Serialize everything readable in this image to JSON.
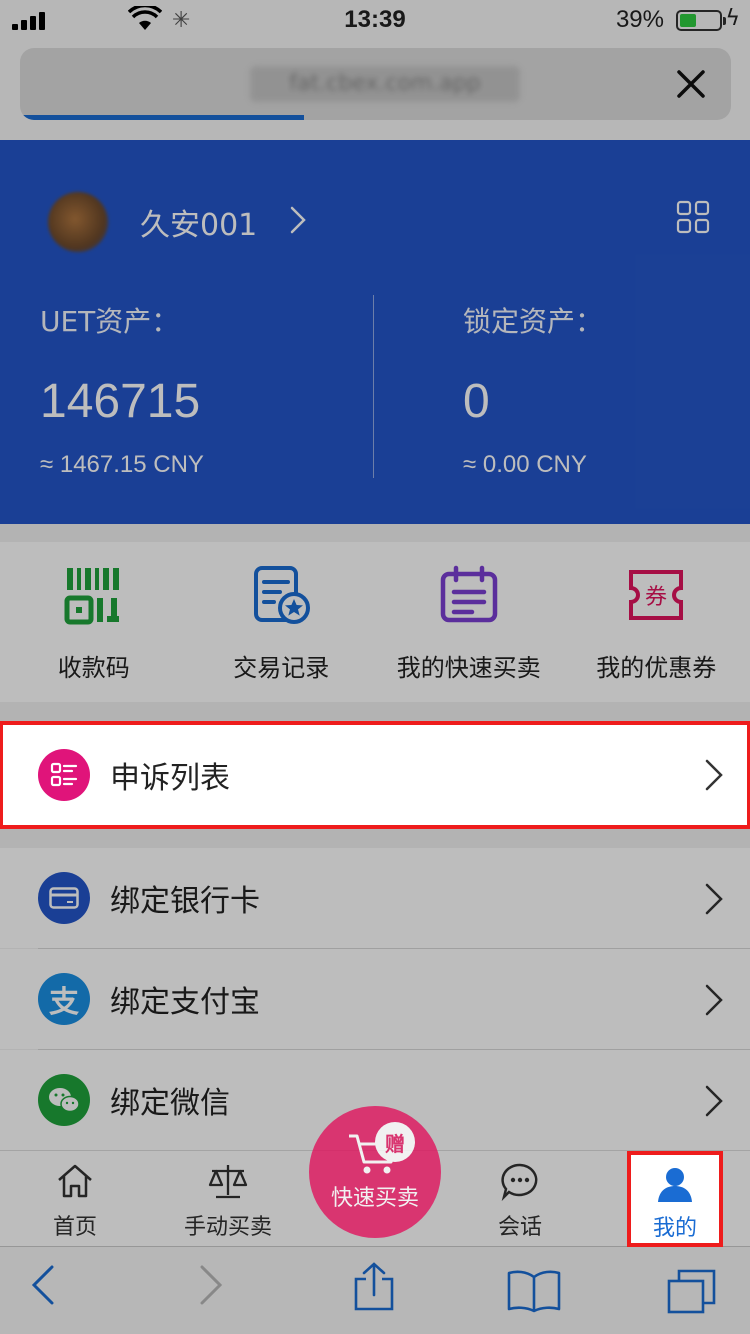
{
  "status_bar": {
    "time": "13:39",
    "battery_percent": "39%"
  },
  "browser": {
    "url": "fat.cbex.com.app",
    "load_progress": 0.4,
    "close_label": "close"
  },
  "user": {
    "name": "久安001"
  },
  "assets": {
    "uet": {
      "label": "UET资产：",
      "value": "146715",
      "cny": "≈  1467.15  CNY"
    },
    "locked": {
      "label": "锁定资产：",
      "value": "0",
      "cny": "≈  0.00  CNY"
    }
  },
  "shortcuts": [
    {
      "label": "收款码",
      "icon": "qr-code-icon",
      "color": "#1fa33c"
    },
    {
      "label": "交易记录",
      "icon": "record-icon",
      "color": "#1a6cd3"
    },
    {
      "label": "我的快速买卖",
      "icon": "calendar-list-icon",
      "color": "#7b3fd3"
    },
    {
      "label": "我的优惠券",
      "icon": "coupon-icon",
      "color": "#e0145d",
      "badge": "券"
    }
  ],
  "list": [
    {
      "label": "申诉列表",
      "icon": "appeal-list-icon",
      "color": "#e0147a"
    },
    {
      "label": "绑定银行卡",
      "icon": "bank-card-icon",
      "color": "#2456c9"
    },
    {
      "label": "绑定支付宝",
      "icon": "alipay-icon",
      "color": "#1a8fe3",
      "glyph": "支"
    },
    {
      "label": "绑定微信",
      "icon": "wechat-icon",
      "color": "#1fa33c"
    }
  ],
  "tabs": {
    "home": "首页",
    "manual": "手动买卖",
    "quick": "快速买卖",
    "gift": "赠",
    "chat": "会话",
    "me": "我的"
  },
  "colors": {
    "brand_blue": "#2456c9",
    "accent_pink": "#e0145d",
    "highlight_red": "#ee1c1c"
  }
}
